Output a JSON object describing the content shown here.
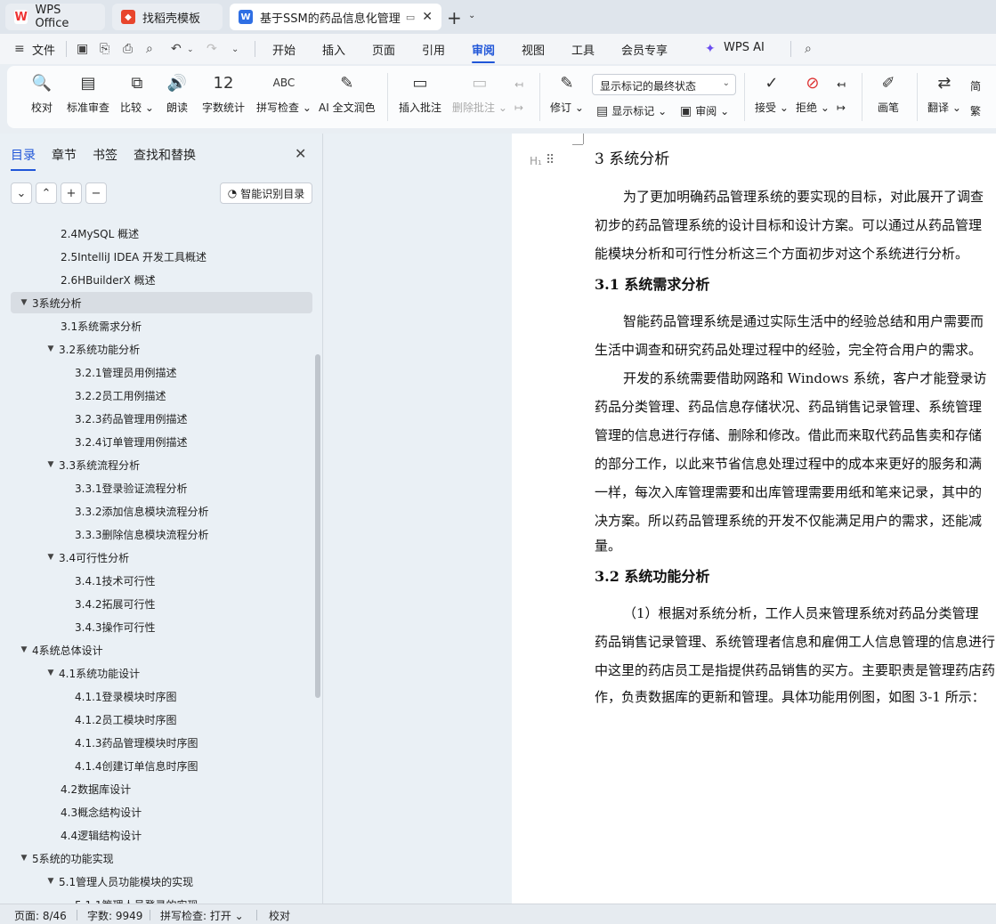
{
  "tabs": {
    "wps": "WPS Office",
    "template": "找稻壳模板",
    "document": "基于SSM的药品信息化管理系"
  },
  "menu": {
    "file": "文件",
    "items": [
      "开始",
      "插入",
      "页面",
      "引用",
      "审阅",
      "视图",
      "工具",
      "会员专享"
    ],
    "active": "审阅",
    "wps_ai": "WPS AI"
  },
  "ribbon": {
    "proofread": "校对",
    "standard_review": "标准审查",
    "compare": "比较",
    "read_aloud": "朗读",
    "word_count": "字数统计",
    "spell_check": "拼写检查",
    "ai_polish": "AI 全文润色",
    "insert_comment": "插入批注",
    "delete_comment": "删除批注",
    "track_changes": "修订",
    "markup_select": "显示标记的最终状态",
    "show_markup": "显示标记",
    "review_pane": "审阅",
    "accept": "接受",
    "reject": "拒绝",
    "pen": "画笔",
    "translate": "翻译",
    "simp_cn": "简",
    "trad_cn": "繁"
  },
  "nav": {
    "tab_toc": "目录",
    "tab_chapter": "章节",
    "tab_bookmark": "书签",
    "tab_find": "查找和替换",
    "smart_toc": "智能识别目录",
    "toc": [
      {
        "label": "2.4MySQL 概述",
        "level": 2,
        "caret": ""
      },
      {
        "label": "2.5IntelliJ IDEA 开发工具概述",
        "level": 2,
        "caret": ""
      },
      {
        "label": "2.6HBuilderX 概述",
        "level": 2,
        "caret": ""
      },
      {
        "label": "3系统分析",
        "level": 1,
        "caret": "▼",
        "active": true
      },
      {
        "label": "3.1系统需求分析",
        "level": 2,
        "caret": ""
      },
      {
        "label": "3.2系统功能分析",
        "level": 2,
        "caret": "▼"
      },
      {
        "label": "3.2.1管理员用例描述",
        "level": 3,
        "caret": ""
      },
      {
        "label": "3.2.2员工用例描述",
        "level": 3,
        "caret": ""
      },
      {
        "label": "3.2.3药品管理用例描述",
        "level": 3,
        "caret": ""
      },
      {
        "label": "3.2.4订单管理用例描述",
        "level": 3,
        "caret": ""
      },
      {
        "label": "3.3系统流程分析",
        "level": 2,
        "caret": "▼"
      },
      {
        "label": "3.3.1登录验证流程分析",
        "level": 3,
        "caret": ""
      },
      {
        "label": "3.3.2添加信息模块流程分析",
        "level": 3,
        "caret": ""
      },
      {
        "label": "3.3.3删除信息模块流程分析",
        "level": 3,
        "caret": ""
      },
      {
        "label": "3.4可行性分析",
        "level": 2,
        "caret": "▼"
      },
      {
        "label": "3.4.1技术可行性",
        "level": 3,
        "caret": ""
      },
      {
        "label": "3.4.2拓展可行性",
        "level": 3,
        "caret": ""
      },
      {
        "label": "3.4.3操作可行性",
        "level": 3,
        "caret": ""
      },
      {
        "label": "4系统总体设计",
        "level": 1,
        "caret": "▼"
      },
      {
        "label": "4.1系统功能设计",
        "level": 2,
        "caret": "▼"
      },
      {
        "label": "4.1.1登录模块时序图",
        "level": 3,
        "caret": ""
      },
      {
        "label": "4.1.2员工模块时序图",
        "level": 3,
        "caret": ""
      },
      {
        "label": "4.1.3药品管理模块时序图",
        "level": 3,
        "caret": ""
      },
      {
        "label": "4.1.4创建订单信息时序图",
        "level": 3,
        "caret": ""
      },
      {
        "label": "4.2数据库设计",
        "level": 2,
        "caret": ""
      },
      {
        "label": "4.3概念结构设计",
        "level": 2,
        "caret": ""
      },
      {
        "label": "4.4逻辑结构设计",
        "level": 2,
        "caret": ""
      },
      {
        "label": "5系统的功能实现",
        "level": 1,
        "caret": "▼"
      },
      {
        "label": "5.1管理人员功能模块的实现",
        "level": 2,
        "caret": "▼"
      },
      {
        "label": "5.1.1管理人员登录的实现",
        "level": 3,
        "caret": ""
      }
    ]
  },
  "document": {
    "lines": [
      {
        "text": "3  系统分析",
        "kind": "h1"
      },
      {
        "text": "为了更加明确药品管理系统的要实现的目标，对此展开了调查",
        "kind": "p",
        "indent": true
      },
      {
        "text": "初步的药品管理系统的设计目标和设计方案。可以通过从药品管理",
        "kind": "p"
      },
      {
        "text": "能模块分析和可行性分析这三个方面初步对这个系统进行分析。",
        "kind": "p"
      },
      {
        "text": "3.1  系统需求分析",
        "kind": "h2"
      },
      {
        "text": "智能药品管理系统是通过实际生活中的经验总结和用户需要而",
        "kind": "p",
        "indent": true
      },
      {
        "text": "生活中调查和研究药品处理过程中的经验，完全符合用户的需求。",
        "kind": "p"
      },
      {
        "text": "开发的系统需要借助网路和 Windows 系统，客户才能登录访",
        "kind": "p",
        "indent": true
      },
      {
        "text": "药品分类管理、药品信息存储状况、药品销售记录管理、系统管理",
        "kind": "p"
      },
      {
        "text": "管理的信息进行存储、删除和修改。借此而来取代药品售卖和存储",
        "kind": "p"
      },
      {
        "text": "的部分工作，以此来节省信息处理过程中的成本来更好的服务和满",
        "kind": "p"
      },
      {
        "text": "一样，每次入库管理需要和出库管理需要用纸和笔来记录，其中的",
        "kind": "p"
      },
      {
        "text": "决方案。所以药品管理系统的开发不仅能满足用户的需求，还能减",
        "kind": "p"
      },
      {
        "text": "量。",
        "kind": "p"
      },
      {
        "text": "3.2  系统功能分析",
        "kind": "h2"
      },
      {
        "text": "（1）根据对系统分析，工作人员来管理系统对药品分类管理",
        "kind": "p",
        "indent": true
      },
      {
        "text": "药品销售记录管理、系统管理者信息和雇佣工人信息管理的信息进行",
        "kind": "p"
      },
      {
        "text": "中这里的药店员工是指提供药品销售的买方。主要职责是管理药店药品",
        "kind": "p"
      },
      {
        "text": "作，负责数据库的更新和管理。具体功能用例图，如图 3-1 所示：",
        "kind": "p"
      }
    ]
  },
  "status": {
    "page": "页面: 8/46",
    "words": "字数: 9949",
    "spell": "拼写检查: 打开",
    "proof": "校对"
  }
}
